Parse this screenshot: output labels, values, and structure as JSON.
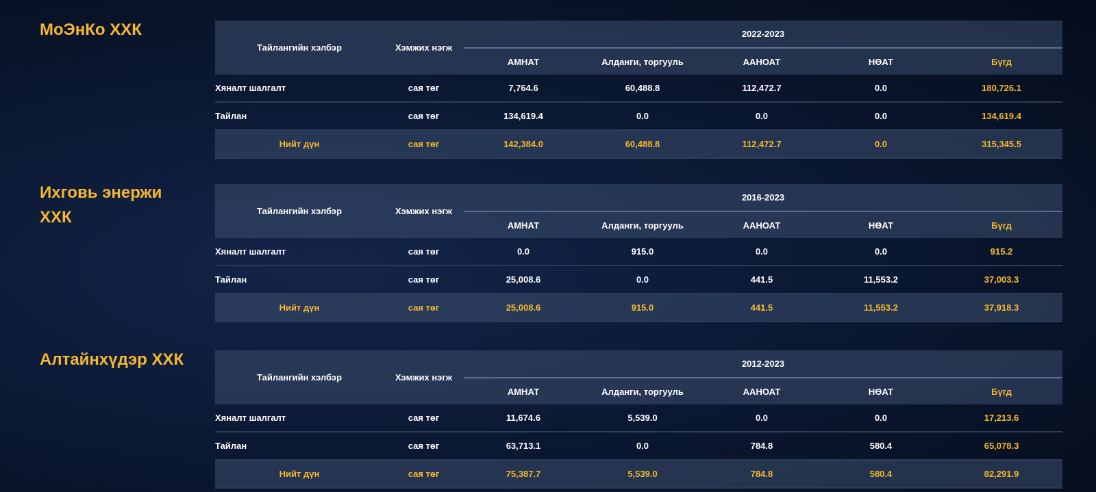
{
  "header_labels": {
    "report_type": "Тайлангийн хэлбэр",
    "unit": "Хэмжих нэгж",
    "columns": [
      "АМНАТ",
      "Алданги, торгууль",
      "ААНОАТ",
      "НӨАТ",
      "Бүгд"
    ]
  },
  "sections": [
    {
      "company": "МоЭнКо ХХК",
      "period": "2022-2023",
      "rows": [
        {
          "label": "Хяналт шалгалт",
          "unit": "сая төг",
          "values": [
            "7,764.6",
            "60,488.8",
            "112,472.7",
            "0.0",
            "180,726.1"
          ]
        },
        {
          "label": "Тайлан",
          "unit": "сая төг",
          "values": [
            "134,619.4",
            "0.0",
            "0.0",
            "0.0",
            "134,619.4"
          ]
        }
      ],
      "total": {
        "label": "Нийт дүн",
        "unit": "сая төг",
        "values": [
          "142,384.0",
          "60,488.8",
          "112,472.7",
          "0.0",
          "315,345.5"
        ]
      }
    },
    {
      "company": "Ихговь энержи ХХК",
      "period": "2016-2023",
      "rows": [
        {
          "label": "Хяналт шалгалт",
          "unit": "сая төг",
          "values": [
            "0.0",
            "915.0",
            "0.0",
            "0.0",
            "915.2"
          ]
        },
        {
          "label": "Тайлан",
          "unit": "сая төг",
          "values": [
            "25,008.6",
            "0.0",
            "441.5",
            "11,553.2",
            "37,003.3"
          ]
        }
      ],
      "total": {
        "label": "Нийт дүн",
        "unit": "сая төг",
        "values": [
          "25,008.6",
          "915.0",
          "441.5",
          "11,553.2",
          "37,918.3"
        ]
      }
    },
    {
      "company": "Алтайнхүдэр ХХК",
      "period": "2012-2023",
      "rows": [
        {
          "label": "Хяналт шалгалт",
          "unit": "сая төг",
          "values": [
            "11,674.6",
            "5,539.0",
            "0.0",
            "0.0",
            "17,213.6"
          ]
        },
        {
          "label": "Тайлан",
          "unit": "сая төг",
          "values": [
            "63,713.1",
            "0.0",
            "784.8",
            "580.4",
            "65,078.3"
          ]
        }
      ],
      "total": {
        "label": "Нийт дүн",
        "unit": "сая төг",
        "values": [
          "75,387.7",
          "5,539.0",
          "784.8",
          "580.4",
          "82,291.9"
        ]
      }
    }
  ],
  "colors": {
    "accent": "#f5b82e",
    "text": "#ffffff",
    "header_bg": "#2a3a58",
    "background": "#0c1a36"
  }
}
